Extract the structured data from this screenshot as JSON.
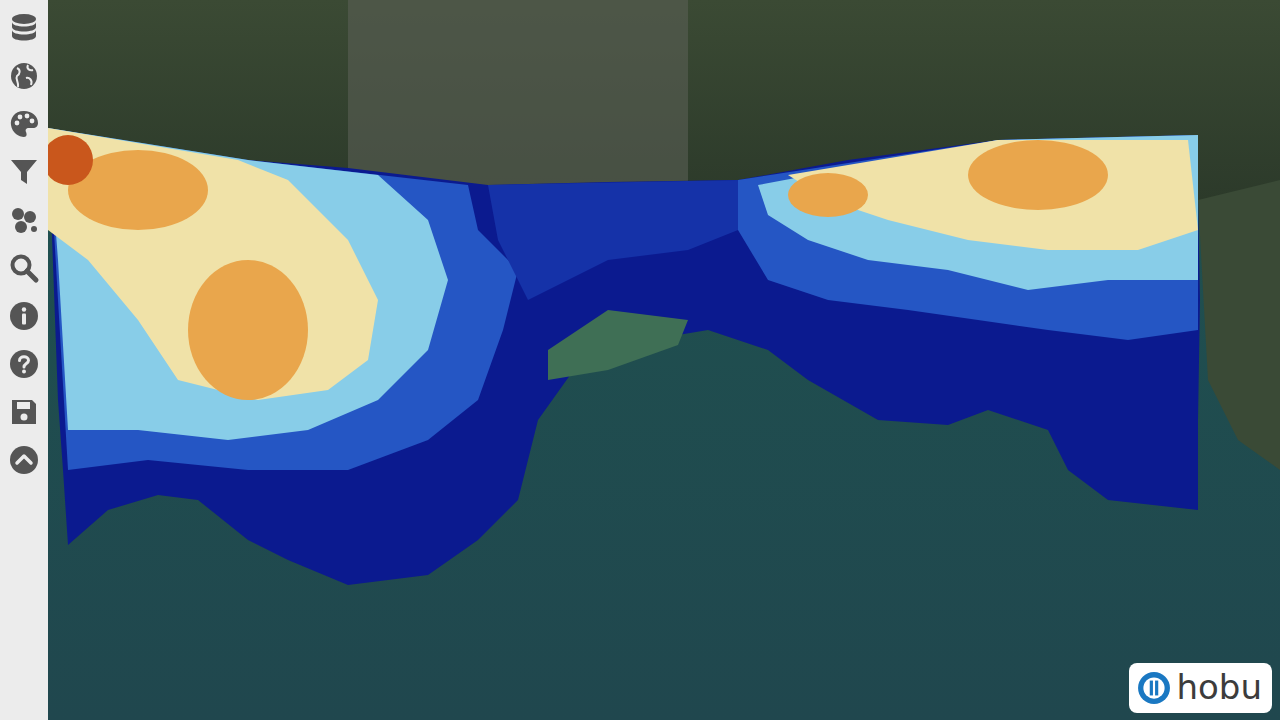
{
  "logo": {
    "text": "hobu"
  }
}
